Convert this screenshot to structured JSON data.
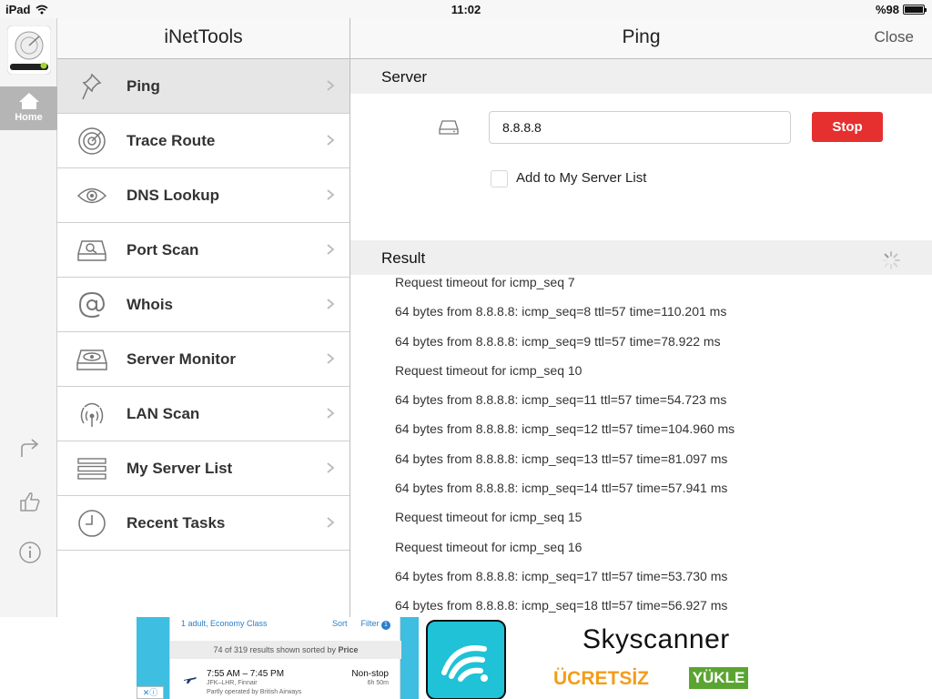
{
  "status_bar": {
    "device": "iPad",
    "time": "11:02",
    "battery": "%98",
    "battery_level": 0.98
  },
  "rail": {
    "home_label": "Home"
  },
  "master": {
    "title": "iNetTools",
    "items": [
      {
        "label": "Ping",
        "icon": "pushpin-icon",
        "selected": true
      },
      {
        "label": "Trace Route",
        "icon": "radar-icon",
        "selected": false
      },
      {
        "label": "DNS Lookup",
        "icon": "eye-icon",
        "selected": false
      },
      {
        "label": "Port Scan",
        "icon": "drive-magnify-icon",
        "selected": false
      },
      {
        "label": "Whois",
        "icon": "at-sign-icon",
        "selected": false
      },
      {
        "label": "Server Monitor",
        "icon": "drive-monitor-icon",
        "selected": false
      },
      {
        "label": "LAN Scan",
        "icon": "broadcast-icon",
        "selected": false
      },
      {
        "label": "My Server List",
        "icon": "list-icon",
        "selected": false
      },
      {
        "label": "Recent Tasks",
        "icon": "clock-icon",
        "selected": false
      }
    ]
  },
  "detail": {
    "title": "Ping",
    "close_label": "Close",
    "server_section": "Server",
    "server_value": "8.8.8.8",
    "stop_label": "Stop",
    "add_to_list_label": "Add to My Server List",
    "result_section": "Result",
    "results": [
      "Request timeout for icmp_seq 7",
      "64 bytes from 8.8.8.8: icmp_seq=8 ttl=57 time=110.201 ms",
      "64 bytes from 8.8.8.8: icmp_seq=9 ttl=57 time=78.922 ms",
      "Request timeout for icmp_seq 10",
      "64 bytes from 8.8.8.8: icmp_seq=11 ttl=57 time=54.723 ms",
      "64 bytes from 8.8.8.8: icmp_seq=12 ttl=57 time=104.960 ms",
      "64 bytes from 8.8.8.8: icmp_seq=13 ttl=57 time=81.097 ms",
      "64 bytes from 8.8.8.8: icmp_seq=14 ttl=57 time=57.941 ms",
      "Request timeout for icmp_seq 15",
      "Request timeout for icmp_seq 16",
      "64 bytes from 8.8.8.8: icmp_seq=17 ttl=57 time=53.730 ms",
      "64 bytes from 8.8.8.8: icmp_seq=18 ttl=57 time=56.927 ms"
    ]
  },
  "ad": {
    "filter_row_left": "1 adult, Economy Class",
    "sort_label": "Sort",
    "filter_label": "Filter",
    "filter_count": "1",
    "results_summary_prefix": "74 of 319 results shown sorted by",
    "results_summary_sort": "Price",
    "flight_times": "7:55 AM – 7:45 PM",
    "flight_route": "JFK–LHR, Finnair",
    "flight_operator": "Partly operated by British Airways",
    "flight_stops": "Non-stop",
    "flight_duration": "6h 50m",
    "brand": "Skyscanner",
    "free_label": "ÜCRETSİZ",
    "get_label": "YÜKLE"
  },
  "colors": {
    "stop": "#e5302f",
    "selected_row": "#e6e6e6",
    "ad_free": "#f39c1a",
    "ad_get": "#5aa532",
    "ad_logo": "#1fc2d6"
  }
}
